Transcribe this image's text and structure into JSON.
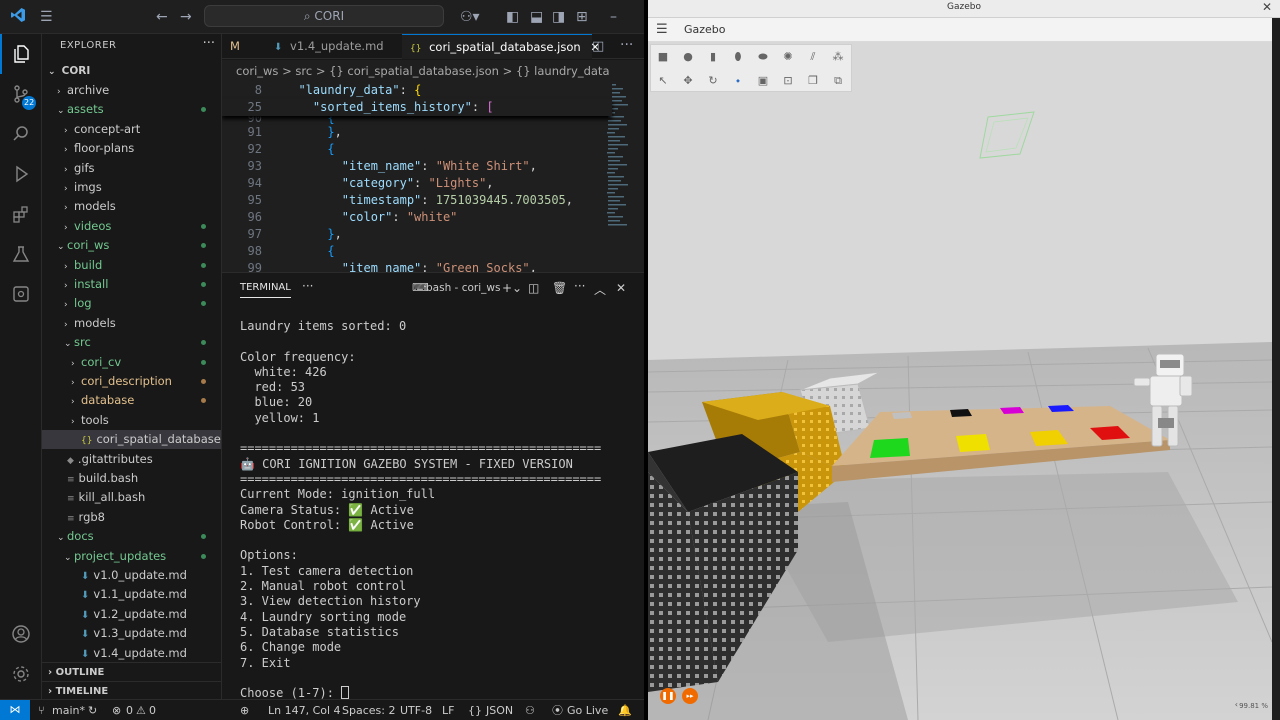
{
  "vscode": {
    "titlebar": {
      "search_text": "CORI"
    },
    "activity_badge": "22",
    "sidebar": {
      "title": "EXPLORER",
      "root": "CORI",
      "items": [
        {
          "label": "archive",
          "depth": 1,
          "type": "folder",
          "open": false
        },
        {
          "label": "assets",
          "depth": 1,
          "type": "folder",
          "open": true,
          "status": "green"
        },
        {
          "label": "concept-art",
          "depth": 2,
          "type": "folder",
          "open": false
        },
        {
          "label": "floor-plans",
          "depth": 2,
          "type": "folder",
          "open": false
        },
        {
          "label": "gifs",
          "depth": 2,
          "type": "folder",
          "open": false
        },
        {
          "label": "imgs",
          "depth": 2,
          "type": "folder",
          "open": false
        },
        {
          "label": "models",
          "depth": 2,
          "type": "folder",
          "open": false
        },
        {
          "label": "videos",
          "depth": 2,
          "type": "folder",
          "open": false,
          "status": "green"
        },
        {
          "label": "cori_ws",
          "depth": 1,
          "type": "folder",
          "open": true,
          "status": "green"
        },
        {
          "label": "build",
          "depth": 2,
          "type": "folder",
          "open": false,
          "status": "green"
        },
        {
          "label": "install",
          "depth": 2,
          "type": "folder",
          "open": false,
          "status": "green"
        },
        {
          "label": "log",
          "depth": 2,
          "type": "folder",
          "open": false,
          "status": "green"
        },
        {
          "label": "models",
          "depth": 2,
          "type": "folder",
          "open": false
        },
        {
          "label": "src",
          "depth": 2,
          "type": "folder",
          "open": true,
          "status": "green"
        },
        {
          "label": "cori_cv",
          "depth": 3,
          "type": "folder",
          "open": false,
          "status": "green"
        },
        {
          "label": "cori_description",
          "depth": 3,
          "type": "folder",
          "open": false,
          "status": "orange"
        },
        {
          "label": "database",
          "depth": 3,
          "type": "folder",
          "open": false,
          "status": "orange"
        },
        {
          "label": "tools",
          "depth": 3,
          "type": "folder",
          "open": false
        },
        {
          "label": "cori_spatial_database.js...",
          "depth": 3,
          "type": "json",
          "selected": true
        },
        {
          "label": ".gitattributes",
          "depth": 1,
          "type": "file"
        },
        {
          "label": "build.bash",
          "depth": 1,
          "type": "file"
        },
        {
          "label": "kill_all.bash",
          "depth": 1,
          "type": "file"
        },
        {
          "label": "rgb8",
          "depth": 1,
          "type": "file"
        },
        {
          "label": "docs",
          "depth": 1,
          "type": "folder",
          "open": true,
          "status": "green"
        },
        {
          "label": "project_updates",
          "depth": 2,
          "type": "folder",
          "open": true,
          "status": "green"
        },
        {
          "label": "v1.0_update.md",
          "depth": 3,
          "type": "md"
        },
        {
          "label": "v1.1_update.md",
          "depth": 3,
          "type": "md"
        },
        {
          "label": "v1.2_update.md",
          "depth": 3,
          "type": "md"
        },
        {
          "label": "v1.3_update.md",
          "depth": 3,
          "type": "md"
        },
        {
          "label": "v1.4_update.md",
          "depth": 3,
          "type": "md"
        }
      ],
      "outline": "OUTLINE",
      "timeline": "TIMELINE"
    },
    "tabs": [
      {
        "label": "M",
        "active": false
      },
      {
        "label": "v1.4_update.md",
        "active": false
      },
      {
        "label": "cori_spatial_database.json",
        "active": true
      }
    ],
    "breadcrumb": "cori_ws  >  src  >  {} cori_spatial_database.json  >  {} laundry_data",
    "editor_lines": [
      {
        "num": "8",
        "html": "  <span class='k'>\"laundry_data\"</span><span class='p'>: </span><span class='b1'>{</span>"
      },
      {
        "num": "25",
        "html": "    <span class='k'>\"sorted_items_history\"</span><span class='p'>: </span><span class='b2'>[</span>"
      },
      {
        "num": "90",
        "html": "      <span class='b3'>{</span>"
      },
      {
        "num": "91",
        "html": "      <span class='b3'>}</span><span class='p'>,</span>"
      },
      {
        "num": "92",
        "html": "      <span class='b3'>{</span>"
      },
      {
        "num": "93",
        "html": "        <span class='k'>\"item_name\"</span><span class='p'>: </span><span class='s'>\"White Shirt\"</span><span class='p'>,</span>"
      },
      {
        "num": "94",
        "html": "        <span class='k'>\"category\"</span><span class='p'>: </span><span class='s'>\"Lights\"</span><span class='p'>,</span>"
      },
      {
        "num": "95",
        "html": "        <span class='k'>\"timestamp\"</span><span class='p'>: </span><span class='n'>1751039445.7003505</span><span class='p'>,</span>"
      },
      {
        "num": "96",
        "html": "        <span class='k'>\"color\"</span><span class='p'>: </span><span class='s'>\"white\"</span>"
      },
      {
        "num": "97",
        "html": "      <span class='b3'>}</span><span class='p'>,</span>"
      },
      {
        "num": "98",
        "html": "      <span class='b3'>{</span>"
      },
      {
        "num": "99",
        "html": "        <span class='k'>\"item_name\"</span><span class='p'>: </span><span class='s'>\"Green Socks\"</span><span class='p'>,</span>"
      }
    ],
    "panel": {
      "tab": "TERMINAL",
      "shell": "bash - cori_ws",
      "lines": [
        "Laundry items sorted: 0",
        "",
        "Color frequency:",
        "  white: 426",
        "  red: 53",
        "  blue: 20",
        "  yellow: 1",
        "",
        "==================================================",
        "🤖 CORI IGNITION GAZEBO SYSTEM - FIXED VERSION",
        "==================================================",
        "Current Mode: ignition_full",
        "Camera Status: ✅ Active",
        "Robot Control: ✅ Active",
        "",
        "Options:",
        "1. Test camera detection",
        "2. Manual robot control",
        "3. View detection history",
        "4. Laundry sorting mode",
        "5. Database statistics",
        "6. Change mode",
        "7. Exit",
        "",
        "Choose (1-7): "
      ]
    },
    "statusbar": {
      "branch": "main*",
      "sync": "↻",
      "errors": "0",
      "warnings": "0",
      "position": "Ln 147, Col 4",
      "spaces": "Spaces: 2",
      "encoding": "UTF-8",
      "eol": "LF",
      "language": "JSON",
      "golive": "Go Live"
    }
  },
  "gazebo": {
    "window_title": "Gazebo",
    "app_title": "Gazebo",
    "rtf": "99.81 %",
    "colors": {
      "play_button": "#f06a00",
      "table": "#d6b48a",
      "floor": "#c9c9c9",
      "sky": "#d8d8d8"
    },
    "tiles": [
      {
        "color": "#c0c0c0"
      },
      {
        "color": "#111111"
      },
      {
        "color": "#d600d6"
      },
      {
        "color": "#1a1aff"
      },
      {
        "color": "#1ed81e"
      },
      {
        "color": "#f0e000"
      },
      {
        "color": "#f0d000"
      },
      {
        "color": "#e01010"
      }
    ]
  }
}
